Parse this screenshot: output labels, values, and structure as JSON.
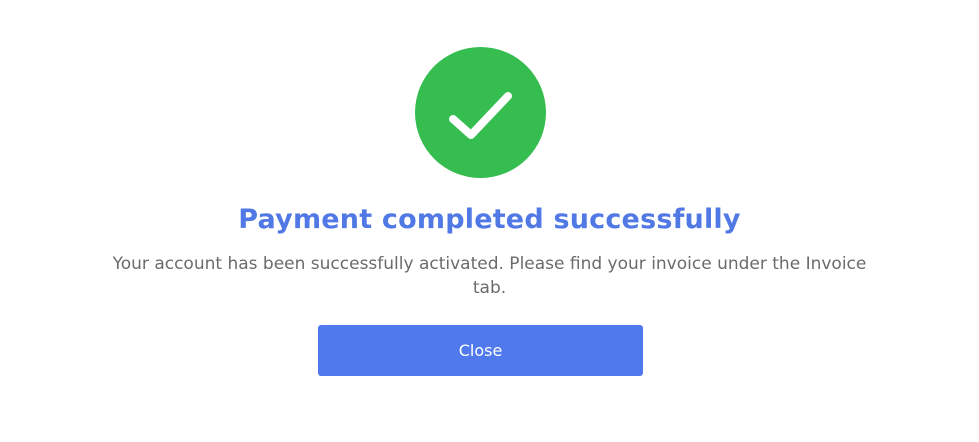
{
  "dialog": {
    "icon": "check-circle-icon",
    "icon_color": "#35bd4f",
    "title": "Payment completed successfully",
    "title_color": "#5179e6",
    "message": "Your account has been successfully activated. Please find your invoice under the Invoice tab.",
    "close_label": "Close",
    "button_color": "#4f79ec"
  }
}
